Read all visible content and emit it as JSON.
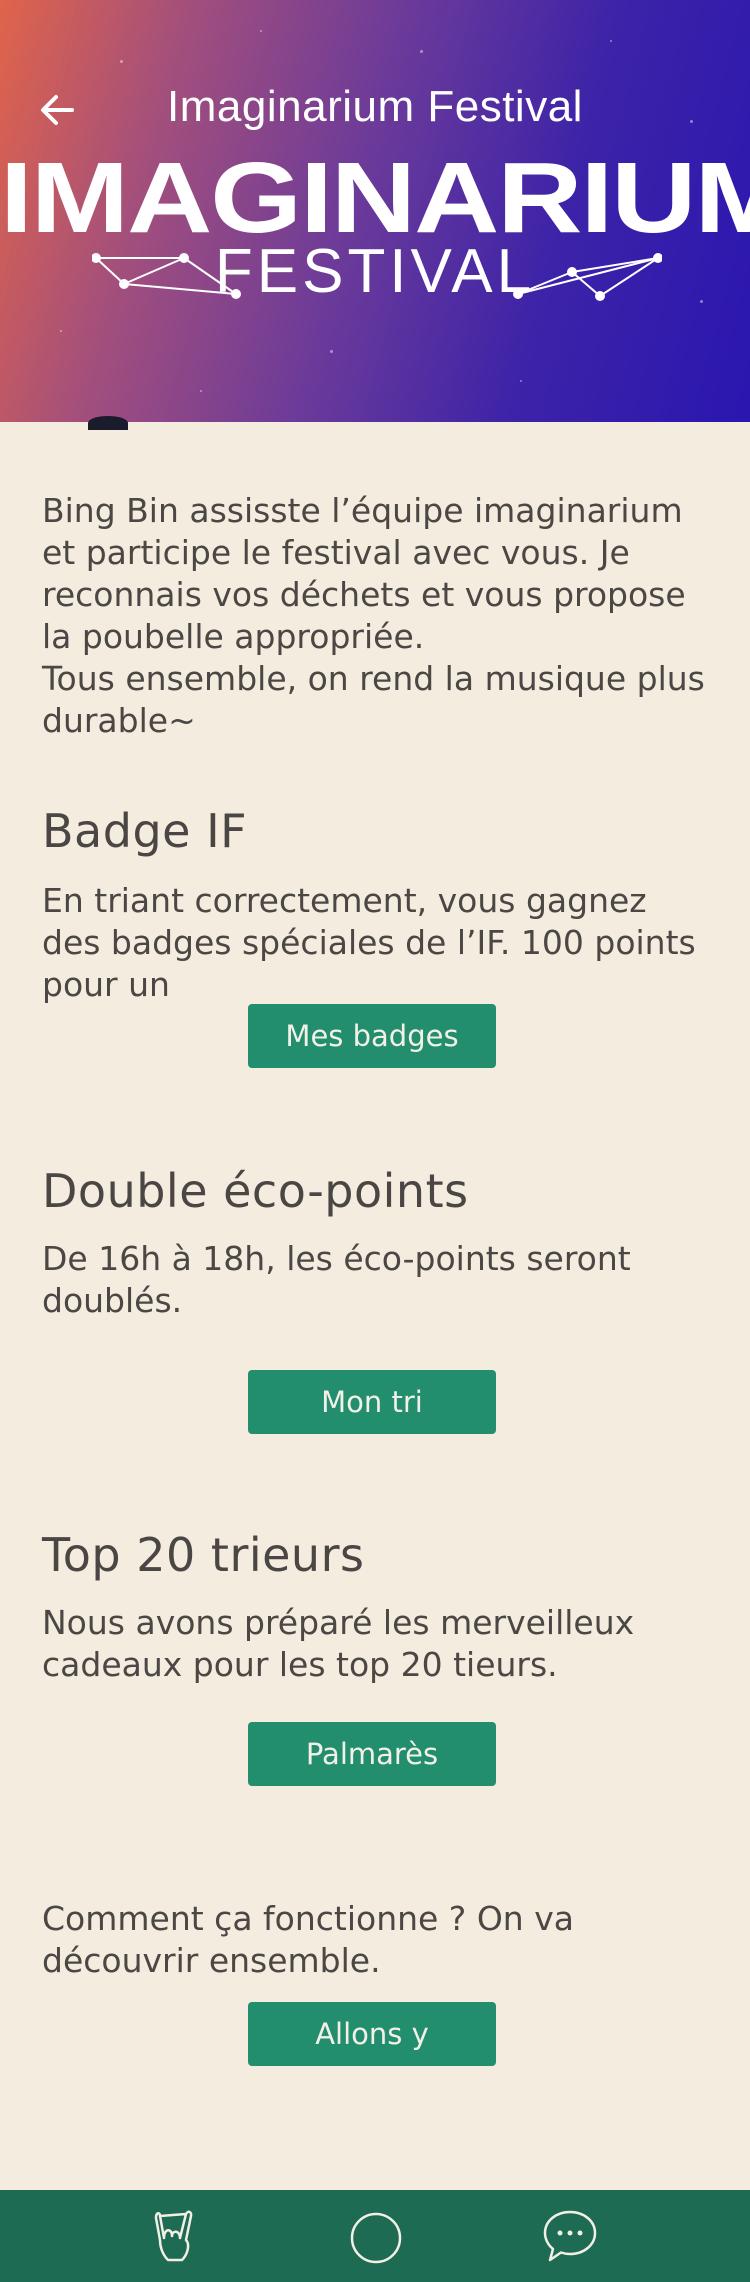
{
  "header": {
    "title": "Imaginarium Festival",
    "back_icon": "arrow-left-icon",
    "logo_main": "IMAGINARIUM",
    "logo_sub": "FESTIVAL"
  },
  "intro": {
    "text": "Bing Bin assisste l’équipe imaginarium et participe le festival avec vous. Je reconnais vos déchets et vous propose la poubelle appropriée.\nTous ensemble, on rend la musique plus durable~"
  },
  "sections": {
    "badge": {
      "title": "Badge IF",
      "text": "En triant correctement, vous gagnez des badges spéciales de l’IF. 100 points pour un",
      "button": "Mes badges"
    },
    "double": {
      "title": "Double éco-points",
      "text": "De 16h à 18h, les éco-points seront doublés.",
      "button": "Mon tri"
    },
    "top": {
      "title": "Top 20 trieurs",
      "text": "Nous avons préparé les merveilleux cadeaux pour les top 20 tieurs.",
      "button": "Palmarès"
    },
    "how": {
      "text": "Comment ça fonctionne ? On va découvrir ensemble.",
      "button": "Allons y"
    }
  },
  "bottom_nav": {
    "items": [
      "rock-hand-icon",
      "circle-icon",
      "chat-bubble-icon"
    ]
  },
  "colors": {
    "background": "#f4ecdf",
    "button": "#228e6d",
    "bottom_bar": "#1d6b52",
    "text": "#4a4744"
  }
}
